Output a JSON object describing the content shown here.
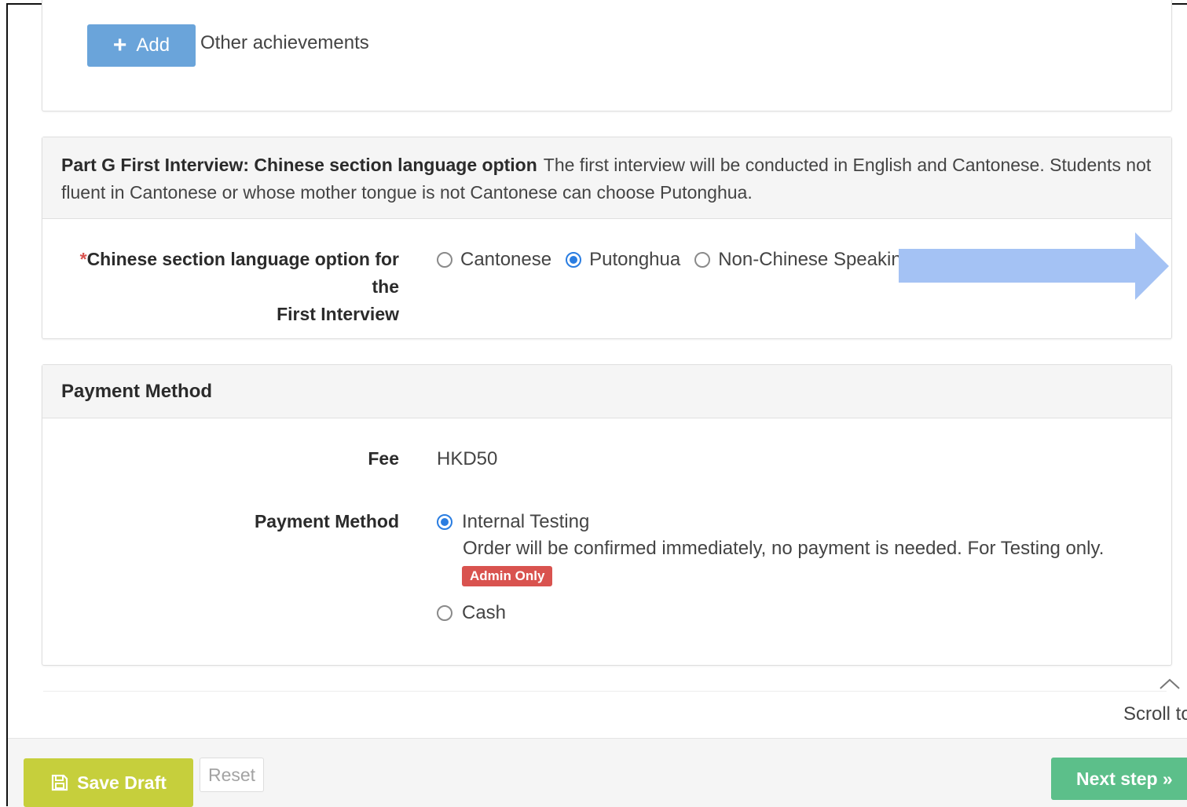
{
  "achievements": {
    "add_label": "Add",
    "label": "Other achievements"
  },
  "part_g": {
    "title": "Part G First Interview: Chinese section language option",
    "description": "The first interview will be conducted in English and Cantonese. Students not fluent in Cantonese or whose mother tongue is not Cantonese can choose Putonghua.",
    "required_mark": "*",
    "question_line1": "Chinese section language option for the",
    "question_line2": "First Interview",
    "options": [
      "Cantonese",
      "Putonghua",
      "Non-Chinese Speaking"
    ],
    "selected": "Putonghua",
    "arrow_color": "#a4c2f4"
  },
  "payment": {
    "title": "Payment Method",
    "fee_label": "Fee",
    "fee_value": "HKD50",
    "method_label": "Payment Method",
    "options": [
      {
        "label": "Internal Testing",
        "description": "Order will be confirmed immediately, no payment is needed. For Testing only.",
        "badge": "Admin Only",
        "selected": true
      },
      {
        "label": "Cash",
        "selected": false
      }
    ]
  },
  "scroll": {
    "label": "Scroll to"
  },
  "footer": {
    "save_label": "Save Draft",
    "reset_label": "Reset",
    "next_label": "Next step »"
  },
  "colors": {
    "primary": "#6aa4da",
    "radio_selected": "#2a7de1",
    "badge": "#d9534f",
    "save": "#c6cf3c",
    "next": "#5cbf8a"
  }
}
